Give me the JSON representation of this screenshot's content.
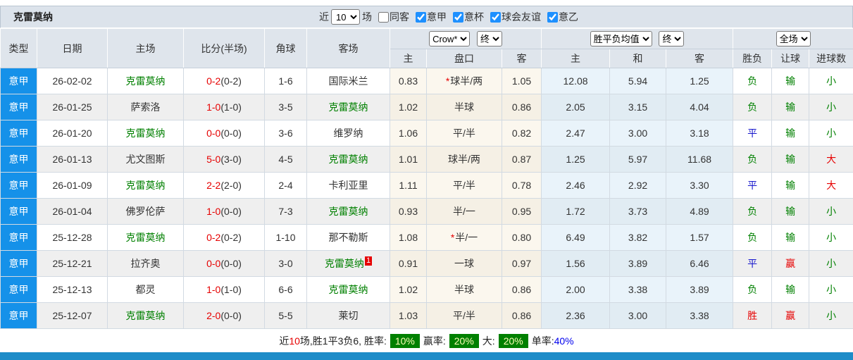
{
  "title": "克雷莫纳",
  "filters": {
    "recent_label": "近",
    "recent_value": "10",
    "matches_label": "场",
    "same_venue_label": "同客",
    "leagues": [
      {
        "label": "意甲"
      },
      {
        "label": "意杯"
      },
      {
        "label": "球会友谊"
      },
      {
        "label": "意乙"
      }
    ]
  },
  "dropdowns": {
    "odds_source": "Crow*",
    "odds_time": "终",
    "avg_source": "胜平负均值",
    "avg_time": "终",
    "scope": "全场"
  },
  "columns": {
    "type": "类型",
    "date": "日期",
    "home": "主场",
    "score": "比分(半场)",
    "corner": "角球",
    "away": "客场",
    "h_home": "主",
    "handicap": "盘口",
    "h_away": "客",
    "avg_home": "主",
    "avg_draw": "和",
    "avg_away": "客",
    "result": "胜负",
    "let_result": "让球",
    "goals": "进球数"
  },
  "colors": {
    "type_cell": "#1591e9",
    "team_highlight": "#008000",
    "score_red": "#e60000",
    "rate_badge_bg": "#008000",
    "rate_badge_text": "#ffffb8",
    "bottom_bar": "#1e8cc8"
  },
  "rows": [
    {
      "type": "意甲",
      "date": "26-02-02",
      "home": "克雷莫纳",
      "home_hl": true,
      "score": "0-2",
      "half": "(0-2)",
      "corner": "1-6",
      "away": "国际米兰",
      "away_hl": false,
      "away_badge": "",
      "h_home": "0.83",
      "handicap": "球半/两",
      "handicap_star": true,
      "h_away": "1.05",
      "avg_home": "12.08",
      "avg_draw": "5.94",
      "avg_away": "1.25",
      "result": "负",
      "result_color": "green",
      "let": "输",
      "let_color": "green",
      "goal": "小",
      "goal_color": "green"
    },
    {
      "type": "意甲",
      "date": "26-01-25",
      "home": "萨索洛",
      "home_hl": false,
      "score": "1-0",
      "half": "(1-0)",
      "corner": "3-5",
      "away": "克雷莫纳",
      "away_hl": true,
      "away_badge": "",
      "h_home": "1.02",
      "handicap": "半球",
      "handicap_star": false,
      "h_away": "0.86",
      "avg_home": "2.05",
      "avg_draw": "3.15",
      "avg_away": "4.04",
      "result": "负",
      "result_color": "green",
      "let": "输",
      "let_color": "green",
      "goal": "小",
      "goal_color": "green"
    },
    {
      "type": "意甲",
      "date": "26-01-20",
      "home": "克雷莫纳",
      "home_hl": true,
      "score": "0-0",
      "half": "(0-0)",
      "corner": "3-6",
      "away": "维罗纳",
      "away_hl": false,
      "away_badge": "",
      "h_home": "1.06",
      "handicap": "平/半",
      "handicap_star": false,
      "h_away": "0.82",
      "avg_home": "2.47",
      "avg_draw": "3.00",
      "avg_away": "3.18",
      "result": "平",
      "result_color": "blue",
      "let": "输",
      "let_color": "green",
      "goal": "小",
      "goal_color": "green"
    },
    {
      "type": "意甲",
      "date": "26-01-13",
      "home": "尤文图斯",
      "home_hl": false,
      "score": "5-0",
      "half": "(3-0)",
      "corner": "4-5",
      "away": "克雷莫纳",
      "away_hl": true,
      "away_badge": "",
      "h_home": "1.01",
      "handicap": "球半/两",
      "handicap_star": false,
      "h_away": "0.87",
      "avg_home": "1.25",
      "avg_draw": "5.97",
      "avg_away": "11.68",
      "result": "负",
      "result_color": "green",
      "let": "输",
      "let_color": "green",
      "goal": "大",
      "goal_color": "red"
    },
    {
      "type": "意甲",
      "date": "26-01-09",
      "home": "克雷莫纳",
      "home_hl": true,
      "score": "2-2",
      "half": "(2-0)",
      "corner": "2-4",
      "away": "卡利亚里",
      "away_hl": false,
      "away_badge": "",
      "h_home": "1.11",
      "handicap": "平/半",
      "handicap_star": false,
      "h_away": "0.78",
      "avg_home": "2.46",
      "avg_draw": "2.92",
      "avg_away": "3.30",
      "result": "平",
      "result_color": "blue",
      "let": "输",
      "let_color": "green",
      "goal": "大",
      "goal_color": "red"
    },
    {
      "type": "意甲",
      "date": "26-01-04",
      "home": "佛罗伦萨",
      "home_hl": false,
      "score": "1-0",
      "half": "(0-0)",
      "corner": "7-3",
      "away": "克雷莫纳",
      "away_hl": true,
      "away_badge": "",
      "h_home": "0.93",
      "handicap": "半/一",
      "handicap_star": false,
      "h_away": "0.95",
      "avg_home": "1.72",
      "avg_draw": "3.73",
      "avg_away": "4.89",
      "result": "负",
      "result_color": "green",
      "let": "输",
      "let_color": "green",
      "goal": "小",
      "goal_color": "green"
    },
    {
      "type": "意甲",
      "date": "25-12-28",
      "home": "克雷莫纳",
      "home_hl": true,
      "score": "0-2",
      "half": "(0-2)",
      "corner": "1-10",
      "away": "那不勒斯",
      "away_hl": false,
      "away_badge": "",
      "h_home": "1.08",
      "handicap": "半/一",
      "handicap_star": true,
      "h_away": "0.80",
      "avg_home": "6.49",
      "avg_draw": "3.82",
      "avg_away": "1.57",
      "result": "负",
      "result_color": "green",
      "let": "输",
      "let_color": "green",
      "goal": "小",
      "goal_color": "green"
    },
    {
      "type": "意甲",
      "date": "25-12-21",
      "home": "拉齐奥",
      "home_hl": false,
      "score": "0-0",
      "half": "(0-0)",
      "corner": "3-0",
      "away": "克雷莫纳",
      "away_hl": true,
      "away_badge": "1",
      "h_home": "0.91",
      "handicap": "一球",
      "handicap_star": false,
      "h_away": "0.97",
      "avg_home": "1.56",
      "avg_draw": "3.89",
      "avg_away": "6.46",
      "result": "平",
      "result_color": "blue",
      "let": "赢",
      "let_color": "red",
      "goal": "小",
      "goal_color": "green"
    },
    {
      "type": "意甲",
      "date": "25-12-13",
      "home": "都灵",
      "home_hl": false,
      "score": "1-0",
      "half": "(1-0)",
      "corner": "6-6",
      "away": "克雷莫纳",
      "away_hl": true,
      "away_badge": "",
      "h_home": "1.02",
      "handicap": "半球",
      "handicap_star": false,
      "h_away": "0.86",
      "avg_home": "2.00",
      "avg_draw": "3.38",
      "avg_away": "3.89",
      "result": "负",
      "result_color": "green",
      "let": "输",
      "let_color": "green",
      "goal": "小",
      "goal_color": "green"
    },
    {
      "type": "意甲",
      "date": "25-12-07",
      "home": "克雷莫纳",
      "home_hl": true,
      "score": "2-0",
      "half": "(0-0)",
      "corner": "5-5",
      "away": "莱切",
      "away_hl": false,
      "away_badge": "",
      "h_home": "1.03",
      "handicap": "平/半",
      "handicap_star": false,
      "h_away": "0.86",
      "avg_home": "2.36",
      "avg_draw": "3.00",
      "avg_away": "3.38",
      "result": "胜",
      "result_color": "red",
      "let": "赢",
      "let_color": "red",
      "goal": "小",
      "goal_color": "green"
    }
  ],
  "summary": {
    "prefix": "近",
    "count": "10",
    "stats": "场,胜1平3负6, 胜率:",
    "win_rate": "10%",
    "label_win": "赢率:",
    "win_odds_rate": "20%",
    "label_big": "大:",
    "big_rate": "20%",
    "label_single": "单率:",
    "single_rate": "40%"
  }
}
